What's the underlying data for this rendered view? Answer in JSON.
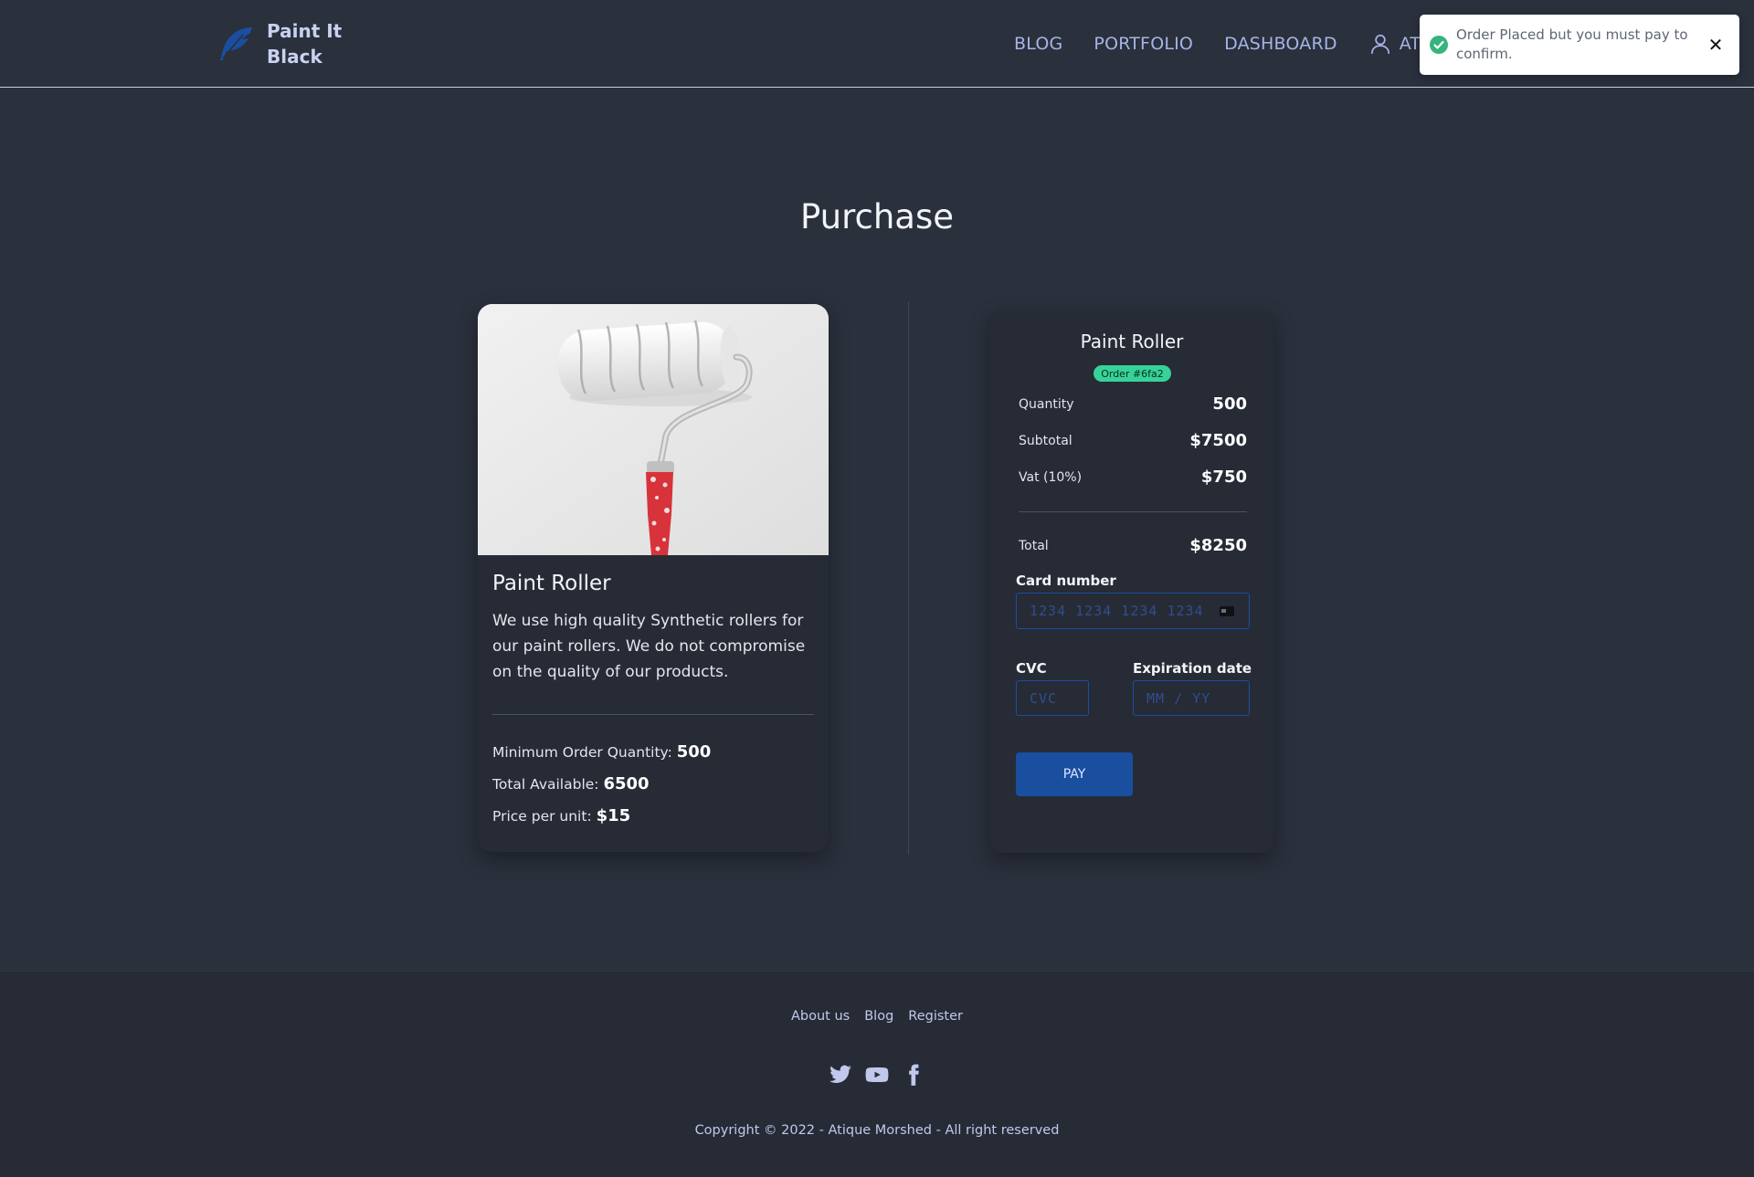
{
  "brand": {
    "name": "Paint It Black",
    "icon": "feather-icon",
    "color": "#1a4fa0"
  },
  "nav": {
    "links": [
      "BLOG",
      "PORTFOLIO",
      "DASHBOARD"
    ],
    "user_label": "ATIQ",
    "user_icon": "user-icon"
  },
  "toast": {
    "message": "Order Placed but you must pay to confirm.",
    "close": "✕",
    "status_color": "#36b37e"
  },
  "page": {
    "title": "Purchase"
  },
  "product": {
    "name": "Paint Roller",
    "description": "We use high quality Synthetic rollers for our paint rollers. We do not compromise on the quality of our products.",
    "min_order_label": "Minimum Order Quantity:",
    "min_order_value": "500",
    "available_label": "Total Available:",
    "available_value": "6500",
    "price_label": "Price per unit:",
    "price_value": "$15"
  },
  "order": {
    "title": "Paint Roller",
    "badge": "Order #6fa2",
    "quantity_label": "Quantity",
    "quantity_value": "500",
    "subtotal_label": "Subtotal",
    "subtotal_value": "$7500",
    "vat_label": "Vat (10%)",
    "vat_value": "$750",
    "total_label": "Total",
    "total_value": "$8250",
    "card_number_label": "Card number",
    "card_number_placeholder": "1234 1234 1234 1234",
    "cvc_label": "CVC",
    "cvc_placeholder": "CVC",
    "expiry_label": "Expiration date",
    "expiry_placeholder": "MM / YY",
    "pay_label": "PAY",
    "accent": "#36d399"
  },
  "footer": {
    "links": [
      "About us",
      "Blog",
      "Register"
    ],
    "social": [
      "twitter-icon",
      "youtube-icon",
      "facebook-icon"
    ],
    "copyright": "Copyright © 2022 - Atique Morshed - All right reserved"
  }
}
